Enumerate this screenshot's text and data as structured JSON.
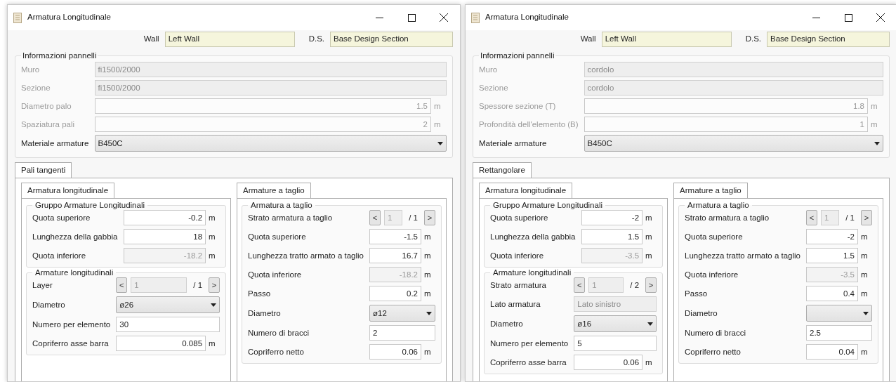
{
  "windows": [
    {
      "title": "Armatura Longitudinale",
      "wall_label": "Wall",
      "wall_value": "Left Wall",
      "ds_label": "D.S.",
      "ds_value": "Base Design Section",
      "info": {
        "title": "Informazioni pannelli",
        "rows": [
          {
            "kind": "text",
            "label": "Muro",
            "value": "fi1500/2000",
            "disabled": true,
            "label_disabled": true
          },
          {
            "kind": "text",
            "label": "Sezione",
            "value": "fi1500/2000",
            "disabled": true,
            "label_disabled": true
          },
          {
            "kind": "unit",
            "label": "Diametro palo",
            "value": "1.5",
            "unit": "m",
            "disabled": true,
            "label_disabled": true
          },
          {
            "kind": "unit",
            "label": "Spaziatura pali",
            "value": "2",
            "unit": "m",
            "disabled": true,
            "label_disabled": true
          },
          {
            "kind": "select",
            "label": "Materiale armature",
            "value": "B450C",
            "disabled": false,
            "label_disabled": false
          }
        ]
      },
      "tab": "Pali tangenti",
      "columns": [
        {
          "tab": "Armatura longitudinale",
          "groups": [
            {
              "title": "Gruppo Armature Longitudinali",
              "rows": [
                {
                  "kind": "unit",
                  "label": "Quota superiore",
                  "value": "-0.2",
                  "unit": "m",
                  "disabled": false
                },
                {
                  "kind": "unit",
                  "label": "Lunghezza della gabbia",
                  "value": "18",
                  "unit": "m",
                  "disabled": false
                },
                {
                  "kind": "unit",
                  "label": "Quota inferiore",
                  "value": "-18.2",
                  "unit": "m",
                  "disabled": true
                }
              ]
            },
            {
              "title": "Armature longitudinali",
              "rows": [
                {
                  "kind": "stepper",
                  "label": "Layer",
                  "prev": "<",
                  "value": "1",
                  "total": "/ 1",
                  "next": ">",
                  "disabled": true
                },
                {
                  "kind": "select",
                  "label": "Diametro",
                  "value": "ø26",
                  "disabled": false
                },
                {
                  "kind": "input",
                  "label": "Numero per elemento",
                  "value": "30",
                  "disabled": false
                },
                {
                  "kind": "unit",
                  "label": "Copriferro asse barra",
                  "value": "0.085",
                  "unit": "m",
                  "disabled": false
                }
              ]
            }
          ]
        },
        {
          "tab": "Armature a taglio",
          "groups": [
            {
              "title": "Armatura a taglio",
              "rows": [
                {
                  "kind": "stepper",
                  "label": "Strato armatura a taglio",
                  "prev": "<",
                  "value": "1",
                  "total": "/ 1",
                  "next": ">",
                  "disabled": true
                },
                {
                  "kind": "unit",
                  "label": "Quota superiore",
                  "value": "-1.5",
                  "unit": "m",
                  "disabled": false
                },
                {
                  "kind": "unit",
                  "label": "Lunghezza tratto armato a taglio",
                  "value": "16.7",
                  "unit": "m",
                  "disabled": false
                },
                {
                  "kind": "unit",
                  "label": "Quota inferiore",
                  "value": "-18.2",
                  "unit": "m",
                  "disabled": true
                },
                {
                  "kind": "unit",
                  "label": "Passo",
                  "value": "0.2",
                  "unit": "m",
                  "disabled": false
                },
                {
                  "kind": "select",
                  "label": "Diametro",
                  "value": "ø12",
                  "disabled": false
                },
                {
                  "kind": "input",
                  "label": "Numero di bracci",
                  "value": "2",
                  "disabled": false
                },
                {
                  "kind": "unit",
                  "label": "Copriferro netto",
                  "value": "0.06",
                  "unit": "m",
                  "disabled": false
                }
              ]
            }
          ]
        }
      ]
    },
    {
      "title": "Armatura Longitudinale",
      "wall_label": "Wall",
      "wall_value": "Left Wall",
      "ds_label": "D.S.",
      "ds_value": "Base Design Section",
      "info": {
        "title": "Informazioni pannelli",
        "rows": [
          {
            "kind": "text",
            "label": "Muro",
            "value": "cordolo",
            "disabled": true,
            "label_disabled": true
          },
          {
            "kind": "text",
            "label": "Sezione",
            "value": "cordolo",
            "disabled": true,
            "label_disabled": true
          },
          {
            "kind": "unit",
            "label": "Spessore sezione (T)",
            "value": "1.8",
            "unit": "m",
            "disabled": true,
            "label_disabled": true
          },
          {
            "kind": "unit",
            "label": "Profondità dell'elemento (B)",
            "value": "1",
            "unit": "m",
            "disabled": true,
            "label_disabled": true
          },
          {
            "kind": "select",
            "label": "Materiale armature",
            "value": "B450C",
            "disabled": false,
            "label_disabled": false
          }
        ]
      },
      "tab": "Rettangolare",
      "columns": [
        {
          "tab": "Armatura longitudinale",
          "groups": [
            {
              "title": "Gruppo Armature Longitudinali",
              "rows": [
                {
                  "kind": "unit",
                  "label": "Quota superiore",
                  "value": "-2",
                  "unit": "m",
                  "disabled": false
                },
                {
                  "kind": "unit",
                  "label": "Lunghezza della gabbia",
                  "value": "1.5",
                  "unit": "m",
                  "disabled": false
                },
                {
                  "kind": "unit",
                  "label": "Quota inferiore",
                  "value": "-3.5",
                  "unit": "m",
                  "disabled": true
                }
              ]
            },
            {
              "title": "Armature longitudinali",
              "rows": [
                {
                  "kind": "stepper",
                  "label": "Strato armatura",
                  "prev": "<",
                  "value": "1",
                  "total": "/ 2",
                  "next": ">",
                  "disabled": true
                },
                {
                  "kind": "text",
                  "label": "Lato armatura",
                  "value": "Lato sinistro",
                  "disabled": true
                },
                {
                  "kind": "select",
                  "label": "Diametro",
                  "value": "ø16",
                  "disabled": false
                },
                {
                  "kind": "input",
                  "label": "Numero per elemento",
                  "value": "5",
                  "disabled": false
                },
                {
                  "kind": "unit",
                  "label": "Copriferro asse barra",
                  "value": "0.06",
                  "unit": "m",
                  "disabled": false
                }
              ]
            }
          ]
        },
        {
          "tab": "Armature a taglio",
          "groups": [
            {
              "title": "Armatura a taglio",
              "rows": [
                {
                  "kind": "stepper",
                  "label": "Strato armatura a taglio",
                  "prev": "<",
                  "value": "1",
                  "total": "/ 1",
                  "next": ">",
                  "disabled": true
                },
                {
                  "kind": "unit",
                  "label": "Quota superiore",
                  "value": "-2",
                  "unit": "m",
                  "disabled": false
                },
                {
                  "kind": "unit",
                  "label": "Lunghezza tratto armato a taglio",
                  "value": "1.5",
                  "unit": "m",
                  "disabled": false
                },
                {
                  "kind": "unit",
                  "label": "Quota inferiore",
                  "value": "-3.5",
                  "unit": "m",
                  "disabled": true
                },
                {
                  "kind": "unit",
                  "label": "Passo",
                  "value": "0.4",
                  "unit": "m",
                  "disabled": false
                },
                {
                  "kind": "select",
                  "label": "Diametro",
                  "value": "",
                  "disabled": false
                },
                {
                  "kind": "input",
                  "label": "Numero di bracci",
                  "value": "2.5",
                  "disabled": false
                },
                {
                  "kind": "unit",
                  "label": "Copriferro netto",
                  "value": "0.04",
                  "unit": "m",
                  "disabled": false
                }
              ]
            }
          ]
        }
      ]
    }
  ]
}
